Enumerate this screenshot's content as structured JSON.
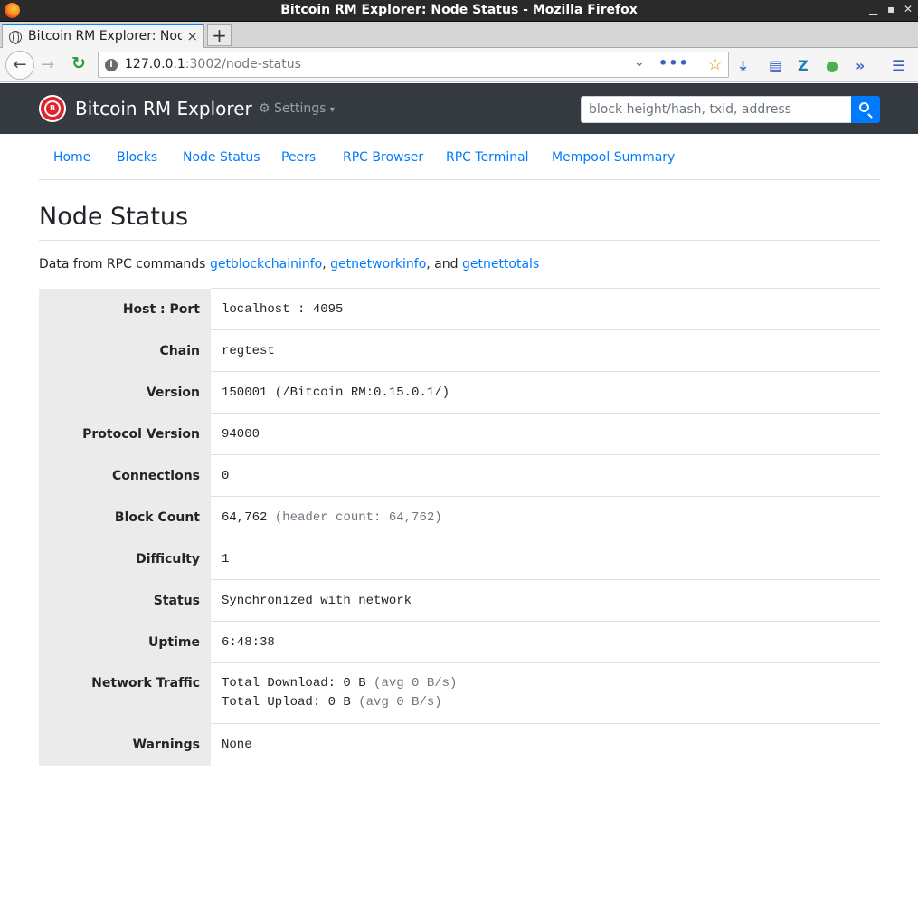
{
  "window": {
    "title": "Bitcoin RM Explorer: Node Status - Mozilla Firefox"
  },
  "tab": {
    "title": "Bitcoin RM Explorer: Node Status",
    "close": "×",
    "new_tab": "+"
  },
  "toolbar": {
    "url_host": "127.0.0.1",
    "url_rest": ":3002/node-status"
  },
  "site": {
    "brand": "Bitcoin RM Explorer",
    "brand_logo_text": "B",
    "settings_label": "Settings",
    "search_placeholder": "block height/hash, txid, address"
  },
  "nav": {
    "links": [
      "Home",
      "Blocks",
      "Node Status",
      "Peers",
      "RPC Browser",
      "RPC Terminal",
      "Mempool Summary"
    ]
  },
  "page": {
    "title": "Node Status",
    "desc_prefix": "Data from RPC commands ",
    "rpc1": "getblockchaininfo",
    "sep1": ", ",
    "rpc2": "getnetworkinfo",
    "sep2": ", and ",
    "rpc3": "getnettotals"
  },
  "status": {
    "host_label": "Host : Port",
    "host_value": "localhost : 4095",
    "chain_label": "Chain",
    "chain_value": "regtest",
    "version_label": "Version",
    "version_value": "150001 (/Bitcoin RM:0.15.0.1/)",
    "protocol_label": "Protocol Version",
    "protocol_value": "94000",
    "connections_label": "Connections",
    "connections_value": "0",
    "blockcount_label": "Block Count",
    "blockcount_value": "64,762",
    "blockcount_header": "(header count: 64,762)",
    "difficulty_label": "Difficulty",
    "difficulty_value": "1",
    "status_label": "Status",
    "status_value": "Synchronized with network",
    "uptime_label": "Uptime",
    "uptime_value": "6:48:38",
    "traffic_label": "Network Traffic",
    "download_value": "Total Download: 0 B",
    "download_avg": "(avg 0 B/s)",
    "upload_value": "Total Upload: 0 B",
    "upload_avg": "(avg 0 B/s)",
    "warnings_label": "Warnings",
    "warnings_value": "None"
  }
}
